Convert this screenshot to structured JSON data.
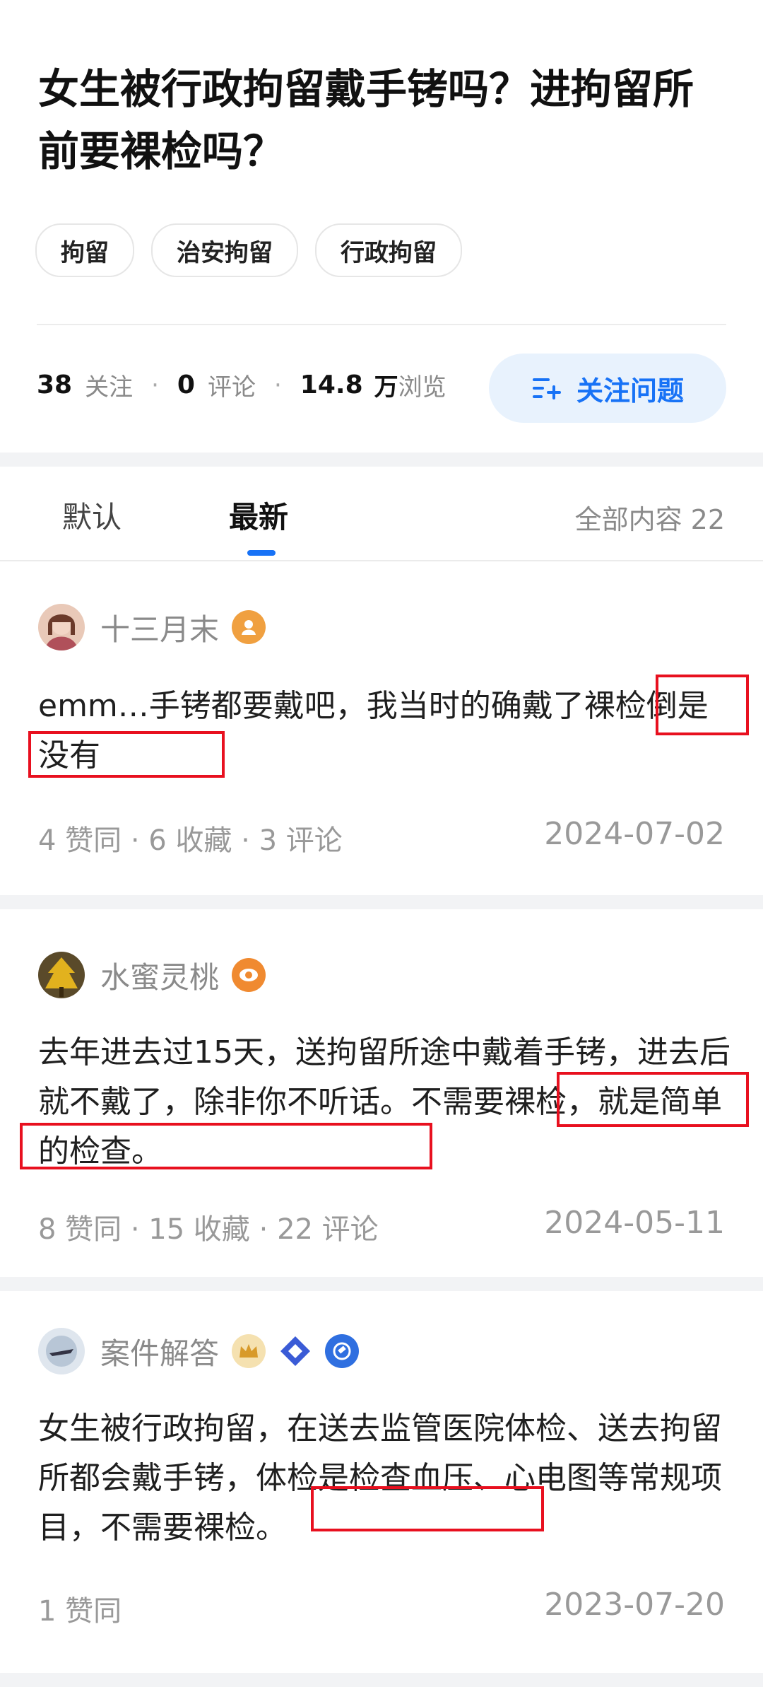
{
  "question": {
    "title": "女生被行政拘留戴手铐吗？进拘留所前要裸检吗？",
    "topics": [
      "拘留",
      "治安拘留",
      "行政拘留"
    ],
    "stats": {
      "follow_count": "38",
      "follow_label": "关注",
      "comment_count": "0",
      "comment_label": "评论",
      "view_count": "14.8",
      "view_unit": "万",
      "view_label": "浏览"
    },
    "follow_button_label": "关注问题"
  },
  "tabs": {
    "items": [
      "默认",
      "最新"
    ],
    "active_index": 1,
    "total_label": "全部内容 22"
  },
  "answers": [
    {
      "author": "十三月末",
      "content": "emm…手铐都要戴吧，我当时的确戴了裸检倒是没有",
      "stats": "4 赞同 · 6 收藏 · 3 评论",
      "date": "2024-07-02",
      "badges": [
        "orange-user-badge-icon"
      ]
    },
    {
      "author": "水蜜灵桃",
      "content": "去年进去过15天，送拘留所途中戴着手铐，进去后就不戴了，除非你不听话。不需要裸检，就是简单的检查。",
      "stats": "8 赞同 · 15 收藏 · 22 评论",
      "date": "2024-05-11",
      "badges": [
        "orange-eye-badge-icon"
      ]
    },
    {
      "author": "案件解答",
      "content": "女生被行政拘留，在送去监管医院体检、送去拘留所都会戴手铐，体检是检查血压、心电图等常规项目，不需要裸检。",
      "stats": "1 赞同",
      "date": "2023-07-20",
      "badges": [
        "gold-crown-badge-icon",
        "blue-diamond-badge-icon",
        "blue-hammer-badge-icon"
      ]
    }
  ],
  "colors": {
    "accent": "#1772f6",
    "highlight_box": "#e8101f",
    "muted_text": "#999999"
  }
}
